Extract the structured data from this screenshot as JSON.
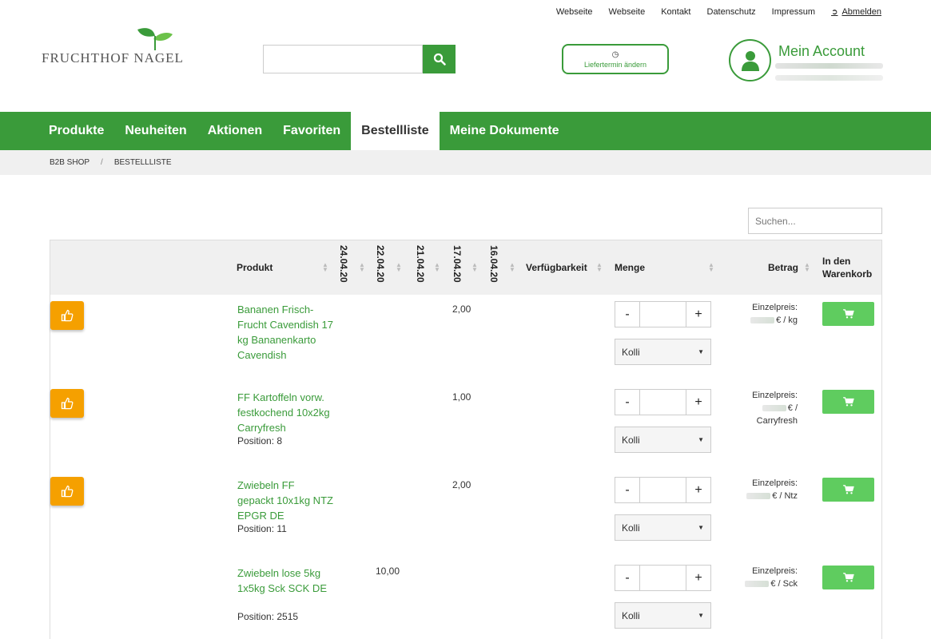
{
  "toplinks": [
    "Webseite",
    "Webseite",
    "Kontakt",
    "Datenschutz",
    "Impressum"
  ],
  "logout_label": "Abmelden",
  "logo_text": "FRUCHTHOF NAGEL",
  "search": {
    "placeholder": ""
  },
  "liefer_label": "Liefertermin ändern",
  "account_title": "Mein Account",
  "nav": [
    "Produkte",
    "Neuheiten",
    "Aktionen",
    "Favoriten",
    "Bestellliste",
    "Meine Dokumente"
  ],
  "nav_active": "Bestellliste",
  "breadcrumb": [
    "B2B SHOP",
    "BESTELLLISTE"
  ],
  "table_search_placeholder": "Suchen...",
  "columns": {
    "produkt": "Produkt",
    "dates": [
      "24.04.20",
      "22.04.20",
      "21.04.20",
      "17.04.20",
      "16.04.20"
    ],
    "verfuegbarkeit": "Verfügbarkeit",
    "menge": "Menge",
    "betrag": "Betrag",
    "warenkorb": "In den Warenkorb"
  },
  "rows": [
    {
      "liked": true,
      "name": "Bananen Frisch-Frucht Cavendish 17 kg Bananenkarto Cavendish",
      "position": "",
      "qty_hist": "2,00",
      "price_label": "Einzelpreis:",
      "unit": "€ / kg",
      "unit_select": "Kolli"
    },
    {
      "liked": true,
      "name": "FF Kartoffeln vorw. festkochend 10x2kg Carryfresh",
      "position": "Position: 8",
      "qty_hist": "1,00",
      "price_label": "Einzelpreis:",
      "unit": "€ / Carryfresh",
      "unit_select": "Kolli"
    },
    {
      "liked": true,
      "name": "Zwiebeln FF gepackt 10x1kg NTZ EPGR DE",
      "position": "Position: 11",
      "qty_hist": "2,00",
      "price_label": "Einzelpreis:",
      "unit": "€ / Ntz",
      "unit_select": "Kolli"
    },
    {
      "liked": false,
      "name": "Zwiebeln lose 5kg 1x5kg Sck SCK DE",
      "position": "Position: 2515",
      "qty_hist": "10,00",
      "price_label": "Einzelpreis:",
      "unit": "€ / Sck",
      "unit_select": "Kolli"
    }
  ],
  "stepper": {
    "minus": "-",
    "plus": "+"
  },
  "colors": {
    "green": "#3a9b3a",
    "orange": "#f5a000",
    "cart": "#5fcc5f"
  }
}
